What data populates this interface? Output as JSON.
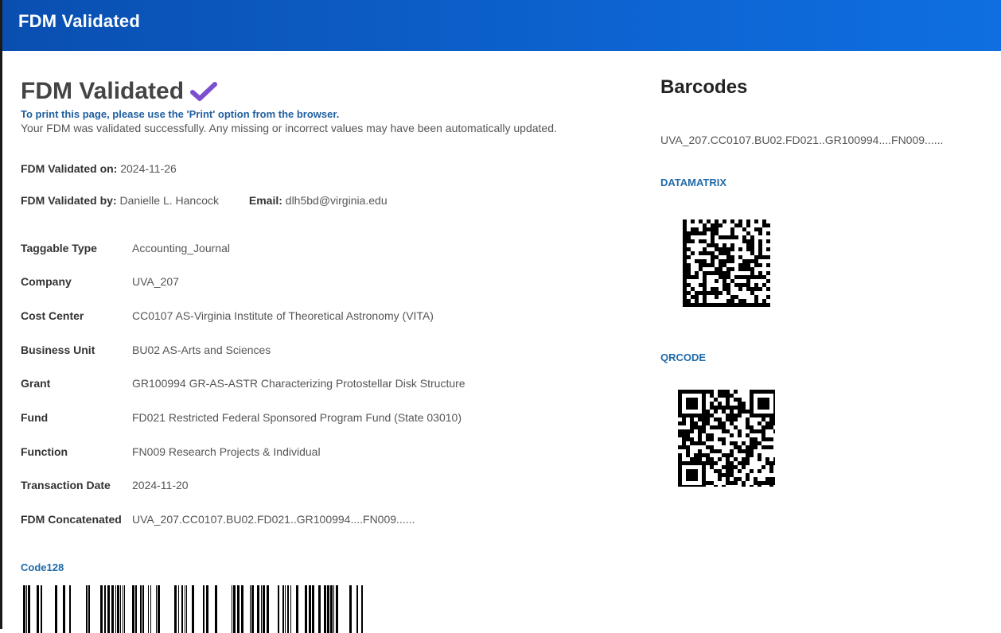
{
  "header": {
    "title": "FDM Validated"
  },
  "main": {
    "title": "FDM Validated",
    "print_note": "To print this page, please use the 'Print' option from the browser.",
    "success_note": "Your FDM was validated successfully. Any missing or incorrect values may have been automatically updated.",
    "validated_on_label": "FDM Validated on:",
    "validated_on_value": "2024-11-26",
    "validated_by_label": "FDM Validated by:",
    "validated_by_value": "Danielle L. Hancock",
    "email_label": "Email:",
    "email_value": "dlh5bd@virginia.edu",
    "fields": [
      {
        "label": "Taggable Type",
        "value": "Accounting_Journal"
      },
      {
        "label": "Company",
        "value": "UVA_207"
      },
      {
        "label": "Cost Center",
        "value": "CC0107 AS-Virginia Institute of Theoretical Astronomy (VITA)"
      },
      {
        "label": "Business Unit",
        "value": "BU02 AS-Arts and Sciences"
      },
      {
        "label": "Grant",
        "value": "GR100994 GR-AS-ASTR Characterizing Protostellar Disk Structure"
      },
      {
        "label": "Fund",
        "value": "FD021 Restricted Federal Sponsored Program Fund (State 03010)"
      },
      {
        "label": "Function",
        "value": "FN009 Research Projects & Individual"
      },
      {
        "label": "Transaction Date",
        "value": "2024-11-20"
      },
      {
        "label": "FDM Concatenated",
        "value": "UVA_207.CC0107.BU02.FD021..GR100994....FN009......"
      }
    ],
    "code128_label": "Code128"
  },
  "barcodes": {
    "title": "Barcodes",
    "concatenated": "UVA_207.CC0107.BU02.FD021..GR100994....FN009......",
    "datamatrix_label": "DATAMATRIX",
    "qrcode_label": "QRCODE"
  },
  "icons": {
    "check": "checkmark-icon"
  },
  "colors": {
    "header_bar": "#0d63d0",
    "accent_link": "#1f6aa8",
    "check": "#7a4fd0"
  }
}
